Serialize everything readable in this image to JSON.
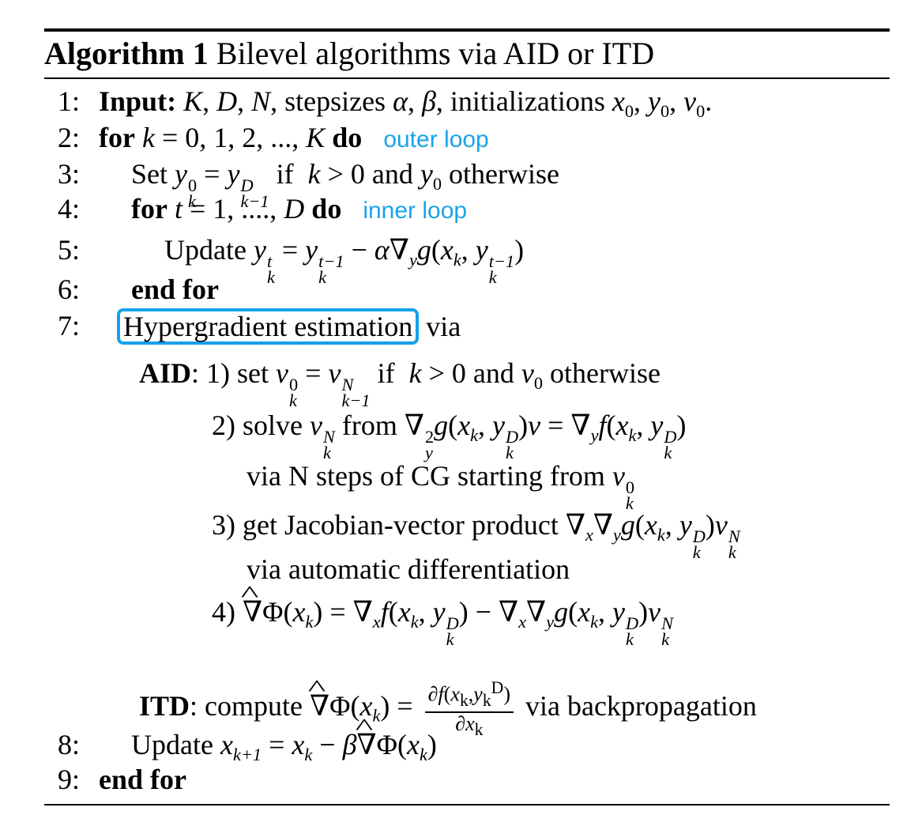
{
  "algorithm": {
    "label": "Algorithm 1",
    "title": "Bilevel algorithms via AID or ITD"
  },
  "lines": [
    {
      "num": "1:",
      "text": "Input: K, D, N, stepsizes α, β, initializations x₀, y₀, v₀."
    },
    {
      "num": "2:",
      "text": "for k = 0, 1, 2, ..., K do",
      "note": "outer loop"
    },
    {
      "num": "3:",
      "text": "Set y_k^0 = y_{k-1}^D if k > 0 and y₀ otherwise"
    },
    {
      "num": "4:",
      "text": "for t = 1, ...., D do",
      "note": "inner loop"
    },
    {
      "num": "5:",
      "text": "Update y_k^t = y_k^{t-1} − α∇_y g(x_k, y_k^{t-1})"
    },
    {
      "num": "6:",
      "text": "end for"
    },
    {
      "num": "7:",
      "text": "Hypergradient estimation via",
      "highlight": "Hypergradient estimation"
    },
    {
      "num": "",
      "text": "AID: 1) set v_k^0 = v_{k-1}^N if k > 0 and v₀ otherwise"
    },
    {
      "num": "",
      "text": "2) solve v_k^N from ∇_y^2 g(x_k, y_k^D)v = ∇_y f(x_k, y_k^D)"
    },
    {
      "num": "",
      "text": "via N steps of CG starting from v_k^0"
    },
    {
      "num": "",
      "text": "3) get Jacobian-vector product ∇_x∇_y g(x_k, y_k^D)v_k^N"
    },
    {
      "num": "",
      "text": "via automatic differentiation"
    },
    {
      "num": "",
      "text": "4) ∇̂Φ(x_k) = ∇_x f(x_k, y_k^D) − ∇_x∇_y g(x_k, y_k^D)v_k^N"
    },
    {
      "num": "",
      "text": "ITD: compute ∇̂Φ(x_k) = ∂f(x_k, y_k^D)/∂x_k via backpropagation"
    },
    {
      "num": "8:",
      "text": "Update x_{k+1} = x_k − β∇̂Φ(x_k)"
    },
    {
      "num": "9:",
      "text": "end for"
    }
  ],
  "labels": {
    "input": "Input:",
    "for": "for",
    "do": "do",
    "end_for": "end for",
    "set": "Set",
    "update": "Update",
    "if": "if",
    "and": "and",
    "otherwise": "otherwise",
    "stepsizes": "stepsizes",
    "initializations": "initializations",
    "outer_loop": "outer loop",
    "inner_loop": "inner loop",
    "hypergradient": "Hypergradient estimation",
    "via": "via",
    "aid": "AID",
    "itd": "ITD",
    "aid_1": "1) set",
    "aid_2": "2) solve",
    "from": "from",
    "aid_2b": "via N steps of CG starting from",
    "aid_3": "3) get Jacobian-vector product",
    "aid_3b": "via automatic differentiation",
    "aid_4": "4)",
    "compute": "compute",
    "backprop": "via backpropagation"
  },
  "colors": {
    "annotation": "#1aa3e8",
    "highlight_box": "#14a1ea"
  }
}
